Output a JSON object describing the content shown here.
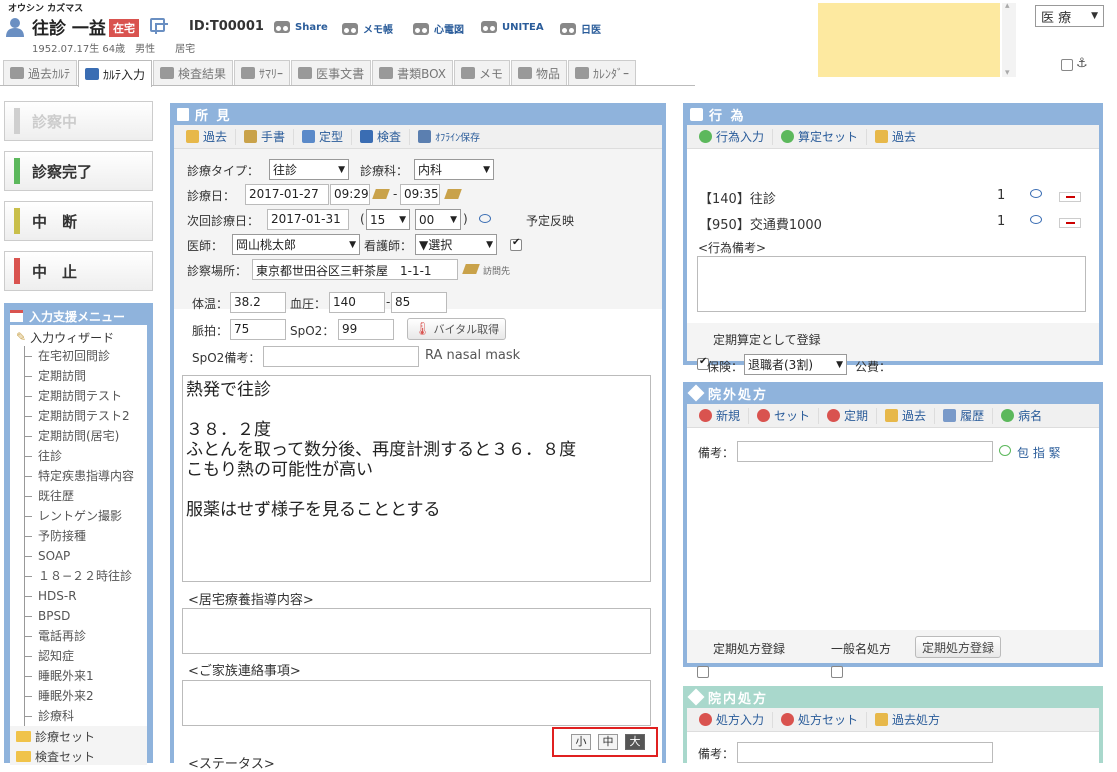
{
  "header": {
    "kana": "オウシン カズマス",
    "name": "往診 一益",
    "status_badge": "在宅",
    "patient_id": "ID:T00001",
    "birth_info": "1952.07.17生 64歳　男性",
    "residence": "居宅",
    "links": [
      "Share",
      "メモ帳",
      "心電図",
      "UNITEA",
      "日医"
    ],
    "dept_select": "医 療"
  },
  "tabs": [
    {
      "label": "過去ｶﾙﾃ",
      "active": false
    },
    {
      "label": "ｶﾙﾃ入力",
      "active": true
    },
    {
      "label": "検査結果",
      "active": false
    },
    {
      "label": "ｻﾏﾘｰ",
      "active": false
    },
    {
      "label": "医事文書",
      "active": false
    },
    {
      "label": "書類BOX",
      "active": false
    },
    {
      "label": "メモ",
      "active": false
    },
    {
      "label": "物品",
      "active": false
    },
    {
      "label": "ｶﾚﾝﾀﾞｰ",
      "active": false
    }
  ],
  "status_buttons": [
    {
      "label": "診察中",
      "color": "#cfcfcf",
      "disabled": true
    },
    {
      "label": "診察完了",
      "color": "#5cb85c",
      "disabled": false
    },
    {
      "label": "中　断",
      "color": "#c9bf4a",
      "disabled": false
    },
    {
      "label": "中　止",
      "color": "#d9534f",
      "disabled": false
    }
  ],
  "menu": {
    "title": "入力支援メニュー",
    "wizard": "入力ウィザード",
    "items": [
      "在宅初回問診",
      "定期訪問",
      "定期訪問テスト",
      "定期訪問テスト2",
      "定期訪問(居宅)",
      "往診",
      "特定疾患指導内容",
      "既往歴",
      "レントゲン撮影",
      "予防接種",
      "SOAP",
      "１８−２２時往診",
      "HDS-R",
      "BPSD",
      "電話再診",
      "認知症",
      "睡眠外来1",
      "睡眠外来2",
      "診療科"
    ],
    "folders": [
      "診療セット",
      "検査セット"
    ]
  },
  "findings": {
    "title": "所 見",
    "toolbar": [
      "過去",
      "手書",
      "定型",
      "検査",
      "ｵﾌﾗｲﾝ保存"
    ],
    "consult_type_label": "診療タイプ：",
    "consult_type": "往診",
    "dept_label": "診療科：",
    "dept": "内科",
    "date_label": "診療日：",
    "date": "2017-01-27",
    "time_from": "09:29",
    "time_sep": "-",
    "time_to": "09:35",
    "next_label": "次回診療日：",
    "next_date": "2017-01-31",
    "next_open": "(",
    "next_hour": "15",
    "next_min": "00",
    "next_close": ")",
    "reflect_label": "予定反映",
    "doctor_label": "医師：",
    "doctor": "岡山桃太郎",
    "nurse_label": "看護師：",
    "nurse": "▼選択",
    "place_label": "診察場所：",
    "place": "東京都世田谷区三軒茶屋　1-1-1",
    "visit_label": "訪問先",
    "temp_label": "体温：",
    "temp": "38.2",
    "bp_label": "血圧：",
    "bp_high": "140",
    "bp_sep": "-",
    "bp_low": "85",
    "pulse_label": "脈拍：",
    "pulse": "75",
    "spo2_label": "SpO2：",
    "spo2": "99",
    "vital_button": "バイタル取得",
    "spo2_note_label": "SpO2備考：",
    "spo2_note": "RA nasal mask",
    "note_lines": [
      "熱発で往診",
      "",
      "３８．２度",
      "ふとんを取って数分後、再度計測すると３６．８度",
      "こもり熱の可能性が高い",
      "",
      "服薬はせず様子を見ることとする"
    ],
    "home_care_label": "<居宅療養指導内容>",
    "family_label": "<ご家族連絡事項>",
    "status_label": "<ステータス>",
    "font_sizes": [
      "小",
      "中",
      "大"
    ]
  },
  "actions": {
    "title": "行 為",
    "toolbar": [
      "行為入力",
      "算定セット",
      "過去"
    ],
    "rows": [
      {
        "code": "【140】往診",
        "qty": "1"
      },
      {
        "code": "【950】交通費1000",
        "qty": "1"
      }
    ],
    "remarks_label": "<行為備考>",
    "regular_label": "定期算定として登録",
    "insurance_label": "保険：",
    "insurance": "退職者(3割)",
    "public_label": "公費："
  },
  "outside_rx": {
    "title": "院外処方",
    "toolbar": [
      "新規",
      "セット",
      "定期",
      "過去",
      "履歴",
      "病名"
    ],
    "remarks_label": "備考：",
    "extras": "包 指 緊",
    "regular_label": "定期処方登録",
    "generic_label": "一般名処方",
    "register_button": "定期処方登録"
  },
  "inside_rx": {
    "title": "院内処方",
    "toolbar": [
      "処方入力",
      "処方セット",
      "過去処方"
    ],
    "remarks_label": "備考："
  }
}
